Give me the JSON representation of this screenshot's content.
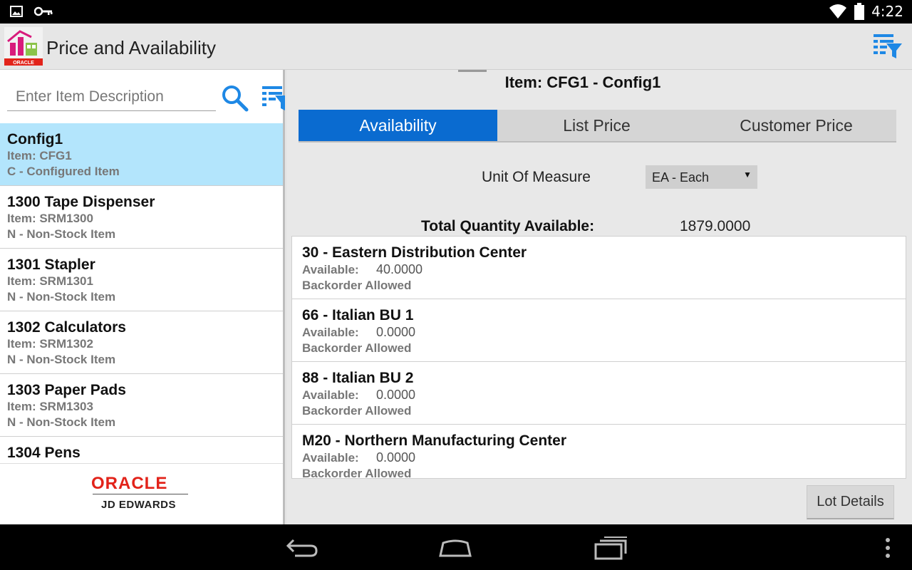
{
  "status_bar": {
    "time": "4:22",
    "icons": [
      "image-icon",
      "key-icon",
      "wifi-icon",
      "battery-icon"
    ]
  },
  "app": {
    "title": "Price and Availability",
    "logo_text": "ORACLE"
  },
  "search": {
    "placeholder": "Enter Item Description",
    "value": ""
  },
  "items": [
    {
      "name": "Config1",
      "item": "Item: CFG1",
      "type": "C - Configured Item",
      "selected": true
    },
    {
      "name": "1300 Tape Dispenser",
      "item": "Item: SRM1300",
      "type": "N - Non-Stock Item",
      "selected": false
    },
    {
      "name": "1301 Stapler",
      "item": "Item: SRM1301",
      "type": "N - Non-Stock Item",
      "selected": false
    },
    {
      "name": "1302 Calculators",
      "item": "Item: SRM1302",
      "type": "N - Non-Stock Item",
      "selected": false
    },
    {
      "name": "1303 Paper Pads",
      "item": "Item: SRM1303",
      "type": "N - Non-Stock Item",
      "selected": false
    },
    {
      "name": "1304 Pens",
      "item": "",
      "type": "",
      "selected": false
    }
  ],
  "footer": {
    "brand": "ORACLE",
    "product": "JD EDWARDS"
  },
  "detail": {
    "header": "Item: CFG1 - Config1",
    "tabs": [
      {
        "label": "Availability",
        "active": true
      },
      {
        "label": "List Price",
        "active": false
      },
      {
        "label": "Customer Price",
        "active": false
      }
    ],
    "uom_label": "Unit Of Measure",
    "uom_value": "EA - Each",
    "total_label": "Total Quantity Available:",
    "total_value": "1879.0000",
    "locations": [
      {
        "name": "30 - Eastern Distribution Center",
        "available_label": "Available:",
        "available": "40.0000",
        "backorder": "Backorder Allowed"
      },
      {
        "name": "66 - Italian BU 1",
        "available_label": "Available:",
        "available": "0.0000",
        "backorder": "Backorder Allowed"
      },
      {
        "name": "88 - Italian BU 2",
        "available_label": "Available:",
        "available": "0.0000",
        "backorder": "Backorder Allowed"
      },
      {
        "name": "M20 - Northern Manufacturing Center",
        "available_label": "Available:",
        "available": "0.0000",
        "backorder": "Backorder Allowed"
      }
    ],
    "lot_button": "Lot Details"
  },
  "colors": {
    "accent": "#0a6bd0",
    "selected_row": "#b3e5fc",
    "oracle_red": "#e2231a"
  }
}
